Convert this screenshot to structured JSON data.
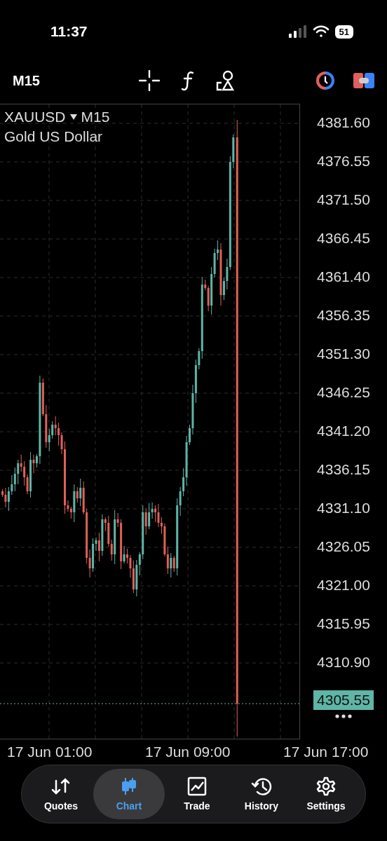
{
  "status_bar": {
    "time": "11:37",
    "battery": "51"
  },
  "toolbar": {
    "timeframe": "M15"
  },
  "chart": {
    "symbol": "XAUUSD",
    "symbol_timeframe": "M15",
    "description": "Gold US Dollar",
    "price_labels": [
      "4381.60",
      "4376.55",
      "4371.50",
      "4366.45",
      "4361.40",
      "4356.35",
      "4351.30",
      "4346.25",
      "4341.20",
      "4336.15",
      "4331.10",
      "4326.05",
      "4321.00",
      "4315.95",
      "4310.90"
    ],
    "current_price": "4305.55",
    "time_labels": [
      "17 Jun 01:00",
      "17 Jun 09:00",
      "17 Jun 17:00"
    ]
  },
  "nav": [
    {
      "label": "Quotes",
      "selected": false
    },
    {
      "label": "Chart",
      "selected": true
    },
    {
      "label": "Trade",
      "selected": false
    },
    {
      "label": "History",
      "selected": false
    },
    {
      "label": "Settings",
      "selected": false
    }
  ]
}
